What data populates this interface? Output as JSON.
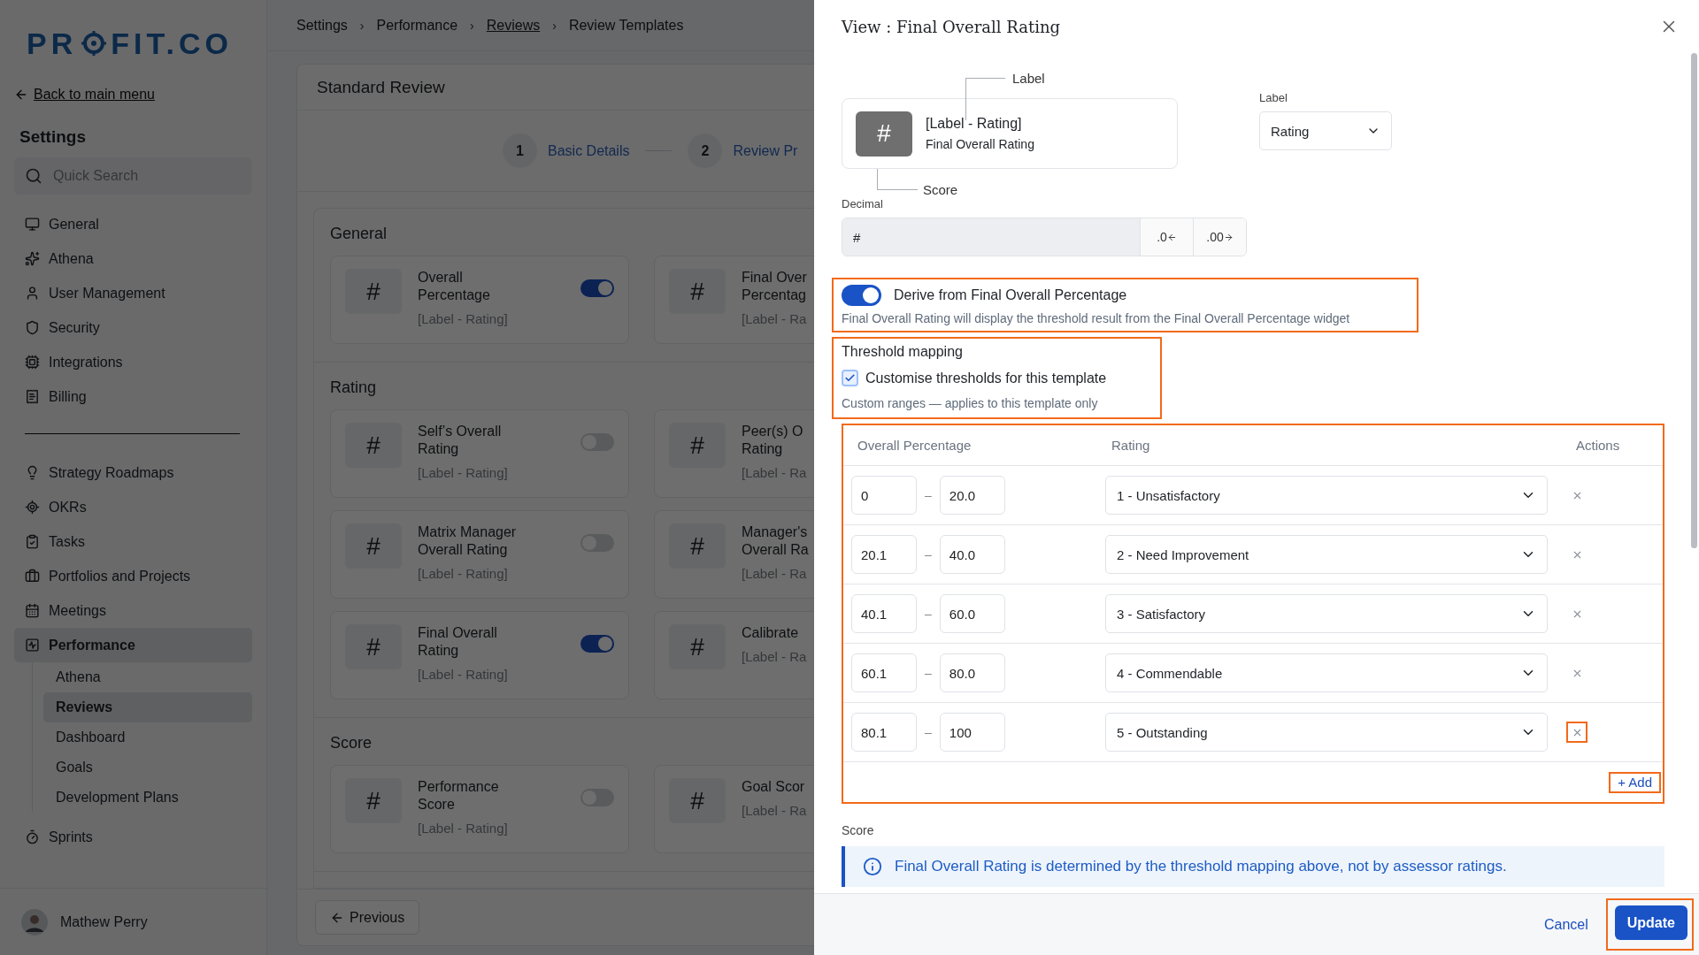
{
  "sidebar": {
    "logo": [
      "PR",
      "FIT.CO"
    ],
    "back_link": "Back to main menu",
    "title": "Settings",
    "search": {
      "placeholder": "Quick Search"
    },
    "groups": [
      [
        {
          "label": "General",
          "selected": false
        },
        {
          "label": "Athena",
          "selected": false
        },
        {
          "label": "User Management",
          "selected": false
        },
        {
          "label": "Security",
          "selected": false
        },
        {
          "label": "Integrations",
          "selected": false
        },
        {
          "label": "Billing",
          "selected": false
        }
      ],
      [
        {
          "label": "Strategy Roadmaps",
          "selected": false
        },
        {
          "label": "OKRs",
          "selected": false
        },
        {
          "label": "Tasks",
          "selected": false
        },
        {
          "label": "Portfolios and Projects",
          "selected": false
        },
        {
          "label": "Meetings",
          "selected": false
        },
        {
          "label": "Performance",
          "selected": true,
          "children": [
            {
              "label": "Athena",
              "selected": false
            },
            {
              "label": "Reviews",
              "selected": true
            },
            {
              "label": "Dashboard",
              "selected": false
            },
            {
              "label": "Goals",
              "selected": false
            },
            {
              "label": "Development Plans",
              "selected": false
            }
          ]
        },
        {
          "label": "Sprints",
          "selected": false
        }
      ]
    ],
    "user": {
      "name": "Mathew Perry"
    }
  },
  "breadcrumb": [
    {
      "kind": "crumb",
      "label": "Settings",
      "link": false
    },
    {
      "kind": "separator",
      "label": "›"
    },
    {
      "kind": "crumb",
      "label": "Performance",
      "link": false
    },
    {
      "kind": "separator",
      "label": "›"
    },
    {
      "kind": "crumb",
      "label": "Reviews",
      "link": true
    },
    {
      "kind": "separator",
      "label": "›"
    },
    {
      "kind": "crumb",
      "label": "Review Templates",
      "link": false
    }
  ],
  "review": {
    "title": "Standard Review",
    "steps": [
      {
        "number": "1",
        "label": "Basic Details"
      },
      {
        "number": "2",
        "label": "Review Pr"
      }
    ],
    "sections": [
      {
        "title": "General",
        "rows": [
          [
            {
              "icon": "#",
              "name": [
                "Overall",
                "Percentage"
              ],
              "tag": "[Label - Rating]",
              "on": true
            },
            {
              "icon": "#",
              "name": [
                "Final Over",
                "Percentag"
              ],
              "tag": "[Label - Ra"
            }
          ]
        ]
      },
      {
        "title": "Rating",
        "rows": [
          [
            {
              "icon": "#",
              "name": [
                "Self’s Overall",
                "Rating"
              ],
              "tag": "[Label - Rating]",
              "on": false
            },
            {
              "icon": "#",
              "name": [
                "Peer(s) O",
                "Rating"
              ],
              "tag": "[Label - Ra"
            }
          ],
          [
            {
              "icon": "#",
              "name": [
                "Matrix Manager",
                "Overall Rating"
              ],
              "tag": "[Label - Rating]",
              "on": false
            },
            {
              "icon": "#",
              "name": [
                "Manager's",
                "Overall Ra"
              ],
              "tag": "[Label - Ra"
            }
          ],
          [
            {
              "icon": "#",
              "name": [
                "Final Overall",
                "Rating"
              ],
              "tag": "[Label - Rating]",
              "on": true
            },
            {
              "icon": "#",
              "name": [
                "Calibrate"
              ],
              "tag": "[Label - Ra"
            }
          ]
        ]
      },
      {
        "title": "Score",
        "rows": [
          [
            {
              "icon": "#",
              "name": [
                "Performance",
                "Score"
              ],
              "tag": "[Label - Rating]",
              "on": false
            },
            {
              "icon": "#",
              "name": [
                "Goal Scor"
              ],
              "tag": "[Label - Ra"
            }
          ]
        ]
      }
    ],
    "previous": "Previous"
  },
  "drawer": {
    "title": "View : Final Overall Rating",
    "preview": {
      "icon": "#",
      "label_note": "Label",
      "score_note": "Score",
      "heading": "[Label - Rating]",
      "subtitle": "Final Overall Rating"
    },
    "label_select": {
      "label": "Label",
      "value": "Rating"
    },
    "decimal": {
      "label": "Decimal",
      "value": "#",
      "buttons": [
        {
          "text": ".0"
        },
        {
          "text": ".00"
        }
      ]
    },
    "derive": {
      "on": true,
      "highlighted": true,
      "label": "Derive from Final Overall Percentage",
      "description": "Final Overall Rating will display the threshold result from the Final Overall Percentage widget"
    },
    "threshold": {
      "highlighted": true,
      "title": "Threshold mapping",
      "checked": true,
      "checkbox_label": "Customise thresholds for this template",
      "hint": "Custom ranges — applies to this template only"
    },
    "table": {
      "highlighted": true,
      "columns": [
        "Overall Percentage",
        "Rating",
        "Actions"
      ],
      "rows": [
        {
          "min": "0",
          "dash": "–",
          "max": "20.0",
          "rating": "1 - Unsatisfactory",
          "highlighted": false
        },
        {
          "min": "20.1",
          "dash": "–",
          "max": "40.0",
          "rating": "2 - Need Improvement",
          "highlighted": false
        },
        {
          "min": "40.1",
          "dash": "–",
          "max": "60.0",
          "rating": "3 - Satisfactory",
          "highlighted": false
        },
        {
          "min": "60.1",
          "dash": "–",
          "max": "80.0",
          "rating": "4 - Commendable",
          "highlighted": false
        },
        {
          "min": "80.1",
          "dash": "–",
          "max": "100",
          "rating": "5 - Outstanding",
          "highlighted": true
        }
      ],
      "add": {
        "label": "+ Add",
        "highlighted": true
      }
    },
    "score_label": "Score",
    "info": "Final Overall Rating is determined by the threshold mapping above, not by assessor ratings.",
    "cancel": "Cancel",
    "update": {
      "label": "Update",
      "highlighted": true
    }
  }
}
